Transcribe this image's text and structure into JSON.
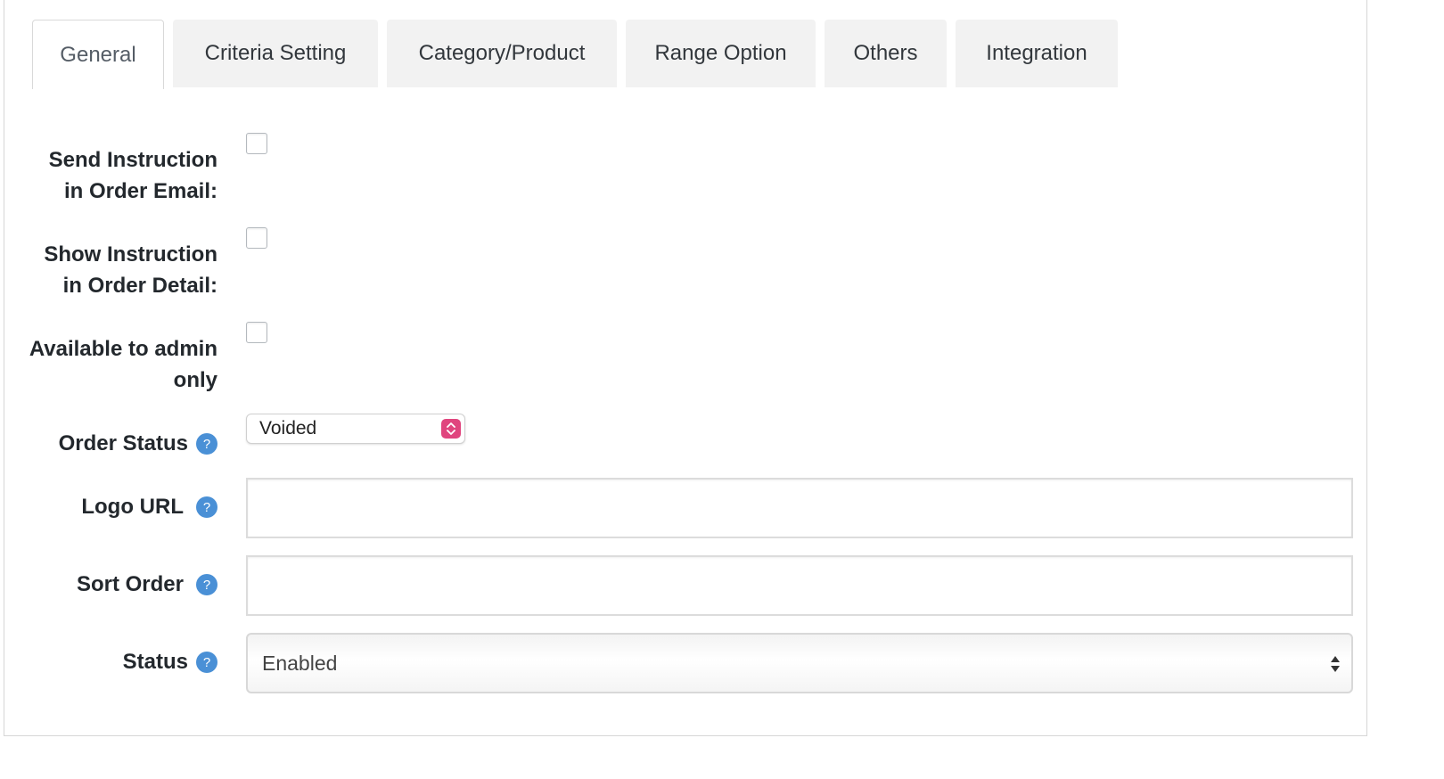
{
  "tabs": [
    {
      "label": "General",
      "active": true
    },
    {
      "label": "Criteria Setting",
      "active": false
    },
    {
      "label": "Category/Product",
      "active": false
    },
    {
      "label": "Range Option",
      "active": false
    },
    {
      "label": "Others",
      "active": false
    },
    {
      "label": "Integration",
      "active": false
    }
  ],
  "form": {
    "send_instruction": {
      "label_line1": "Send Instruction",
      "label_line2": "in Order Email:",
      "checked": false
    },
    "show_instruction": {
      "label_line1": "Show Instruction",
      "label_line2": "in Order Detail:",
      "checked": false
    },
    "admin_only": {
      "label_line1": "Available to admin",
      "label_line2": "only",
      "checked": false
    },
    "order_status": {
      "label": "Order Status",
      "value": "Voided"
    },
    "logo_url": {
      "label": "Logo URL",
      "value": "",
      "placeholder": ""
    },
    "sort_order": {
      "label": "Sort Order",
      "value": "",
      "placeholder": ""
    },
    "status": {
      "label": "Status",
      "value": "Enabled"
    }
  },
  "icons": {
    "help": "?"
  },
  "colors": {
    "help_icon": "#4a90d6",
    "select_accent": "#e0457e"
  }
}
